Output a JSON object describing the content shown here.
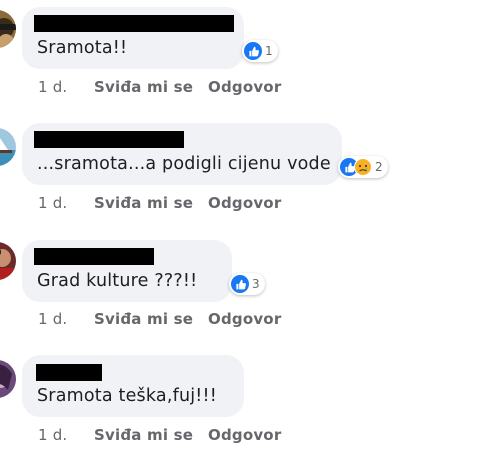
{
  "comments": [
    {
      "text": "Sramota!!",
      "reactions": {
        "types": [
          "like"
        ],
        "count": "1"
      },
      "time": "1 d.",
      "like_label": "Sviđa mi se",
      "reply_label": "Odgovor"
    },
    {
      "text": "...sramota...a podigli cijenu vode",
      "reactions": {
        "types": [
          "like",
          "sad"
        ],
        "count": "2"
      },
      "time": "1 d.",
      "like_label": "Sviđa mi se",
      "reply_label": "Odgovor"
    },
    {
      "text": "Grad kulture ???!!",
      "reactions": {
        "types": [
          "like"
        ],
        "count": "3"
      },
      "time": "1 d.",
      "like_label": "Sviđa mi se",
      "reply_label": "Odgovor"
    },
    {
      "text": "Sramota teška,fuj!!!",
      "reactions": null,
      "time": "1 d.",
      "like_label": "Sviđa mi se",
      "reply_label": "Odgovor"
    }
  ],
  "colors": {
    "bubble": "#f0f2f5",
    "like": "#1877f2",
    "sad": "#f7b125",
    "meta_text": "#65676b"
  }
}
